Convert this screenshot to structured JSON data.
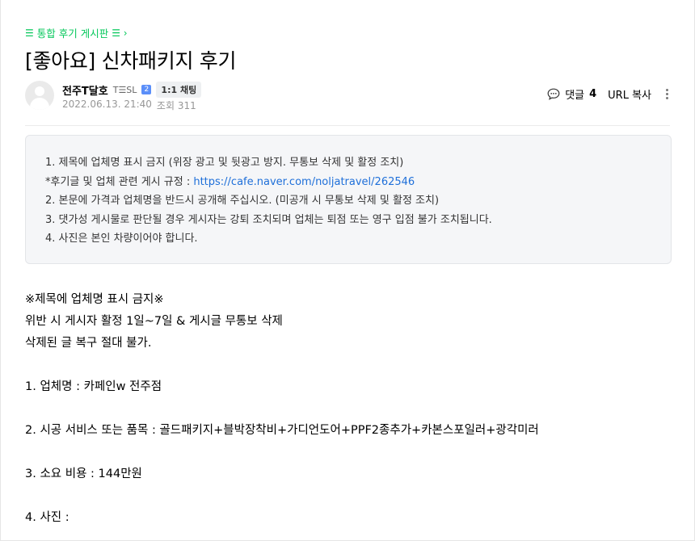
{
  "board": {
    "menu_glyph": "☰",
    "label": "통합 후기 게시판",
    "chevron": "☰ ›"
  },
  "post": {
    "title": "[좋아요] 신차패키지 후기"
  },
  "author": {
    "name": "전주T달호",
    "grade": "T☰SL",
    "grade_badge": "2",
    "chat_label": "1:1 채팅",
    "date": "2022.06.13. 21:40",
    "views": "조회 311"
  },
  "tools": {
    "comment_label": "댓글",
    "comment_count": "4",
    "url_copy_label": "URL 복사",
    "icons": [
      "comment-icon",
      "more-icon"
    ]
  },
  "notice": {
    "line1": "1. 제목에 업체명 표시 금지 (위장 광고 및 뒷광고 방지. 무통보 삭제 및 활정 조치)",
    "line2_prefix": "*후기글 및 업체 관련 게시 규정 : ",
    "line2_link": "https://cafe.naver.com/noljatravel/262546",
    "line3": "2. 본문에 가격과 업체명을 반드시 공개해 주십시오. (미공개 시 무통보 삭제 및 활정 조치)",
    "line4": "3. 댓가성 게시물로 판단될 경우 게시자는 강퇴 조치되며 업체는 퇴점 또는 영구 입점 불가 조치됩니다.",
    "line5": "4. 사진은 본인 차량이어야 합니다."
  },
  "content": {
    "line1": "※제목에 업체명 표시 금지※",
    "line2": "위반 시 게시자 활정 1일~7일 & 게시글 무통보 삭제",
    "line3": "삭제된 글 복구 절대 불가.",
    "line4": "1. 업체명 :  카페인w 전주점",
    "line5": "2. 시공 서비스 또는 품목 :  골드패키지+블박장착비+가디언도어+PPF2종추가+카본스포일러+광각미러",
    "line6": "3. 소요 비용 :  144만원",
    "line7": "4. 사진 :"
  },
  "colors": {
    "accent_green": "#03c75a",
    "link_blue": "#1e6fd9",
    "notice_bg": "#f5f6f8"
  }
}
